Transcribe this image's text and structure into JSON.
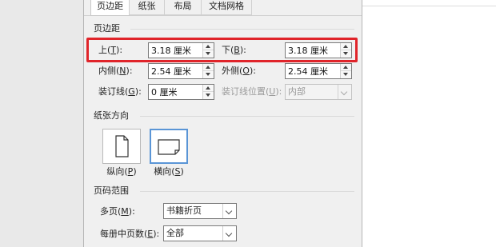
{
  "tabs": [
    "页边距",
    "纸张",
    "布局",
    "文档网格"
  ],
  "margins": {
    "section_title": "页边距",
    "top": {
      "label": "上",
      "key": "T",
      "value": "3.18 厘米"
    },
    "bottom": {
      "label": "下",
      "key": "B",
      "value": "3.18 厘米"
    },
    "inside": {
      "label": "内侧",
      "key": "N",
      "value": "2.54 厘米"
    },
    "outside": {
      "label": "外侧",
      "key": "O",
      "value": "2.54 厘米"
    },
    "gutter": {
      "label": "装订线",
      "key": "G",
      "value": "0 厘米"
    },
    "gutter_pos": {
      "label": "装订线位置",
      "key": "U",
      "value": "内部"
    }
  },
  "orientation": {
    "section_title": "纸张方向",
    "portrait": {
      "label": "纵向",
      "key": "P"
    },
    "landscape": {
      "label": "横向",
      "key": "S"
    },
    "selected": "landscape"
  },
  "pages": {
    "section_title": "页码范围",
    "multiple": {
      "label": "多页",
      "key": "M",
      "value": "书籍折页"
    },
    "sheets": {
      "label": "每册中页数",
      "key": "E",
      "value": "全部"
    }
  },
  "colors": {
    "highlight": "#e0242a",
    "selected_border": "#5a95d6"
  }
}
